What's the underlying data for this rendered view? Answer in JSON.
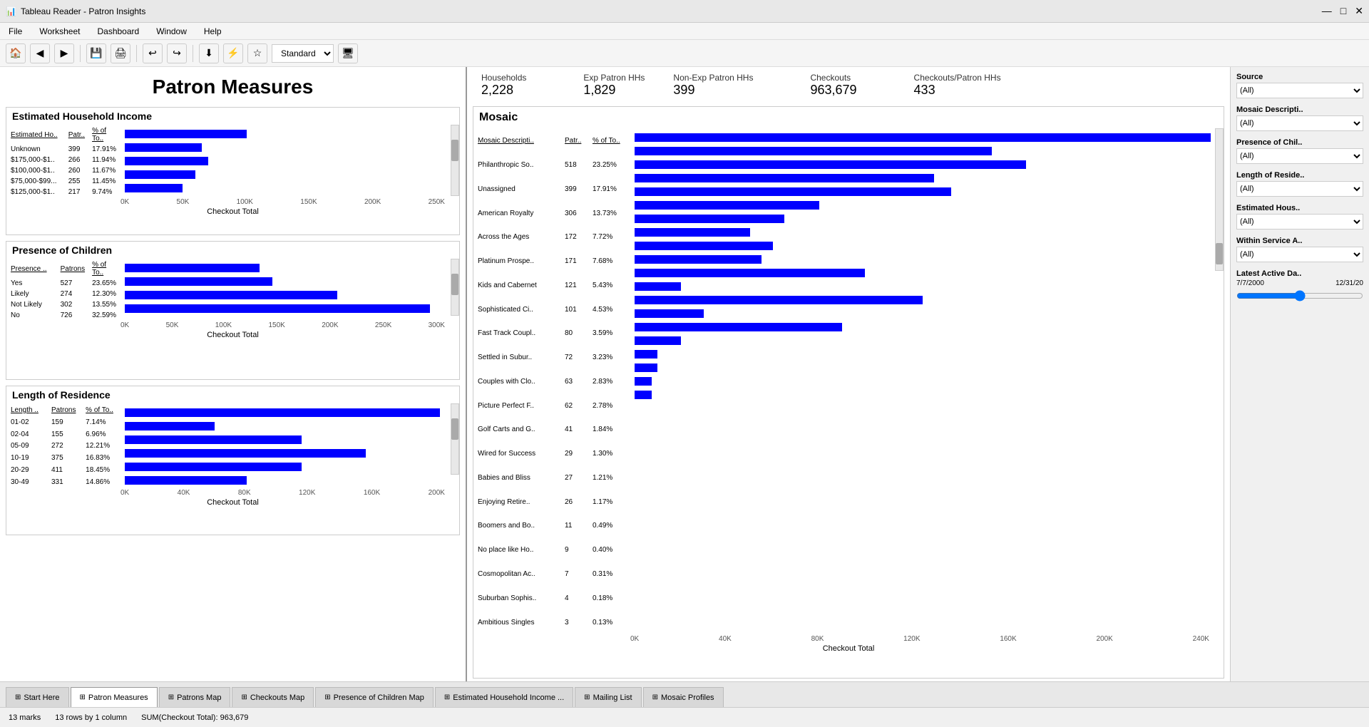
{
  "titleBar": {
    "icon": "📊",
    "title": "Tableau Reader - Patron Insights",
    "minimize": "—",
    "maximize": "□",
    "close": "✕"
  },
  "menuBar": {
    "items": [
      "File",
      "Worksheet",
      "Dashboard",
      "Window",
      "Help"
    ]
  },
  "toolbar": {
    "standardLabel": "Standard"
  },
  "pageTitle": "Patron Measures",
  "metrics": [
    {
      "label": "Households",
      "value": "2,228"
    },
    {
      "label": "Exp Patron HHs",
      "value": "1,829"
    },
    {
      "label": "Non-Exp Patron HHs",
      "value": "399"
    },
    {
      "label": "Checkouts",
      "value": "963,679"
    },
    {
      "label": "Checkouts/Patron HHs",
      "value": "433"
    }
  ],
  "incomeSection": {
    "title": "Estimated Household Income",
    "columns": [
      "Estimated Ho..",
      "Patr..",
      "% of To.."
    ],
    "rows": [
      {
        "label": "Unknown",
        "patrons": "399",
        "pct": "17.91%",
        "bar": 38
      },
      {
        "label": "$175,000-$1..",
        "patrons": "266",
        "pct": "11.94%",
        "bar": 24
      },
      {
        "label": "$100,000-$1..",
        "patrons": "260",
        "pct": "11.67%",
        "bar": 26
      },
      {
        "label": "$75,000-$99...",
        "patrons": "255",
        "pct": "11.45%",
        "bar": 22
      },
      {
        "label": "$125,000-$1..",
        "patrons": "217",
        "pct": "9.74%",
        "bar": 18
      }
    ],
    "xLabels": [
      "0K",
      "50K",
      "100K",
      "150K",
      "200K",
      "250K"
    ],
    "axisLabel": "Checkout Total"
  },
  "childrenSection": {
    "title": "Presence of Children",
    "columns": [
      "Presence ..",
      "Patrons",
      "% of To.."
    ],
    "rows": [
      {
        "label": "Yes",
        "patrons": "527",
        "pct": "23.65%",
        "bar": 42
      },
      {
        "label": "Likely",
        "patrons": "274",
        "pct": "12.30%",
        "bar": 46
      },
      {
        "label": "Not Likely",
        "patrons": "302",
        "pct": "13.55%",
        "bar": 66
      },
      {
        "label": "No",
        "patrons": "726",
        "pct": "32.59%",
        "bar": 95
      }
    ],
    "xLabels": [
      "0K",
      "50K",
      "100K",
      "150K",
      "200K",
      "250K",
      "300K"
    ],
    "axisLabel": "Checkout Total"
  },
  "residenceSection": {
    "title": "Length of Residence",
    "columns": [
      "Length ..",
      "Patrons",
      "% of To.."
    ],
    "rows": [
      {
        "label": "01-02",
        "patrons": "159",
        "pct": "7.14%",
        "bar": 98
      },
      {
        "label": "02-04",
        "patrons": "155",
        "pct": "6.96%",
        "bar": 28
      },
      {
        "label": "05-09",
        "patrons": "272",
        "pct": "12.21%",
        "bar": 55
      },
      {
        "label": "10-19",
        "patrons": "375",
        "pct": "16.83%",
        "bar": 75
      },
      {
        "label": "20-29",
        "patrons": "411",
        "pct": "18.45%",
        "bar": 55
      },
      {
        "label": "30-49",
        "patrons": "331",
        "pct": "14.86%",
        "bar": 38
      }
    ],
    "xLabels": [
      "0K",
      "40K",
      "80K",
      "120K",
      "160K",
      "200K"
    ],
    "axisLabel": "Checkout Total"
  },
  "mosaicSection": {
    "title": "Mosaic",
    "columns": [
      "Mosaic Descripti..",
      "Patr..",
      "% of To.."
    ],
    "rows": [
      {
        "label": "Philanthropic So..",
        "patrons": "518",
        "pct": "23.25%",
        "bar": 100
      },
      {
        "label": "Unassigned",
        "patrons": "399",
        "pct": "17.91%",
        "bar": 62
      },
      {
        "label": "American Royalty",
        "patrons": "306",
        "pct": "13.73%",
        "bar": 68
      },
      {
        "label": "Across the Ages",
        "patrons": "172",
        "pct": "7.72%",
        "bar": 52
      },
      {
        "label": "Platinum Prospe..",
        "patrons": "171",
        "pct": "7.68%",
        "bar": 55
      },
      {
        "label": "Kids and Cabernet",
        "patrons": "121",
        "pct": "5.43%",
        "bar": 32
      },
      {
        "label": "Sophisticated Ci..",
        "patrons": "101",
        "pct": "4.53%",
        "bar": 26
      },
      {
        "label": "Fast Track Coupl..",
        "patrons": "80",
        "pct": "3.59%",
        "bar": 20
      },
      {
        "label": "Settled in Subur..",
        "patrons": "72",
        "pct": "3.23%",
        "bar": 24
      },
      {
        "label": "Couples with Clo..",
        "patrons": "63",
        "pct": "2.83%",
        "bar": 22
      },
      {
        "label": "Picture Perfect F..",
        "patrons": "62",
        "pct": "2.78%",
        "bar": 40
      },
      {
        "label": "Golf Carts and G..",
        "patrons": "41",
        "pct": "1.84%",
        "bar": 8
      },
      {
        "label": "Wired for Success",
        "patrons": "29",
        "pct": "1.30%",
        "bar": 50
      },
      {
        "label": "Babies and Bliss",
        "patrons": "27",
        "pct": "1.21%",
        "bar": 12
      },
      {
        "label": "Enjoying Retire..",
        "patrons": "26",
        "pct": "1.17%",
        "bar": 36
      },
      {
        "label": "Boomers and Bo..",
        "patrons": "11",
        "pct": "0.49%",
        "bar": 8
      },
      {
        "label": "No place like Ho..",
        "patrons": "9",
        "pct": "0.40%",
        "bar": 4
      },
      {
        "label": "Cosmopolitan Ac..",
        "patrons": "7",
        "pct": "0.31%",
        "bar": 4
      },
      {
        "label": "Suburban Sophis..",
        "patrons": "4",
        "pct": "0.18%",
        "bar": 3
      },
      {
        "label": "Ambitious Singles",
        "patrons": "3",
        "pct": "0.13%",
        "bar": 3
      }
    ],
    "xLabels": [
      "0K",
      "40K",
      "80K",
      "120K",
      "160K",
      "200K",
      "240K"
    ],
    "axisLabel": "Checkout Total"
  },
  "filters": [
    {
      "label": "Source",
      "value": "(All)"
    },
    {
      "label": "Mosaic Descripti..",
      "value": "(All)"
    },
    {
      "label": "Presence of Chil..",
      "value": "(All)"
    },
    {
      "label": "Length of Reside..",
      "value": "(All)"
    },
    {
      "label": "Estimated Hous..",
      "value": "(All)"
    },
    {
      "label": "Within Service A..",
      "value": "(All)"
    }
  ],
  "dateFilter": {
    "label": "Latest Active Da..",
    "range": "7/7/2000 12/31/20"
  },
  "tabs": [
    {
      "label": "Start Here",
      "active": false
    },
    {
      "label": "Patron Measures",
      "active": true
    },
    {
      "label": "Patrons Map",
      "active": false
    },
    {
      "label": "Checkouts Map",
      "active": false
    },
    {
      "label": "Presence of Children Map",
      "active": false
    },
    {
      "label": "Estimated Household Income ...",
      "active": false
    },
    {
      "label": "Mailing List",
      "active": false
    },
    {
      "label": "Mosaic Profiles",
      "active": false
    }
  ],
  "statusBar": {
    "marks": "13 marks",
    "rows": "13 rows by 1 column",
    "sum": "SUM(Checkout Total): 963,679"
  }
}
